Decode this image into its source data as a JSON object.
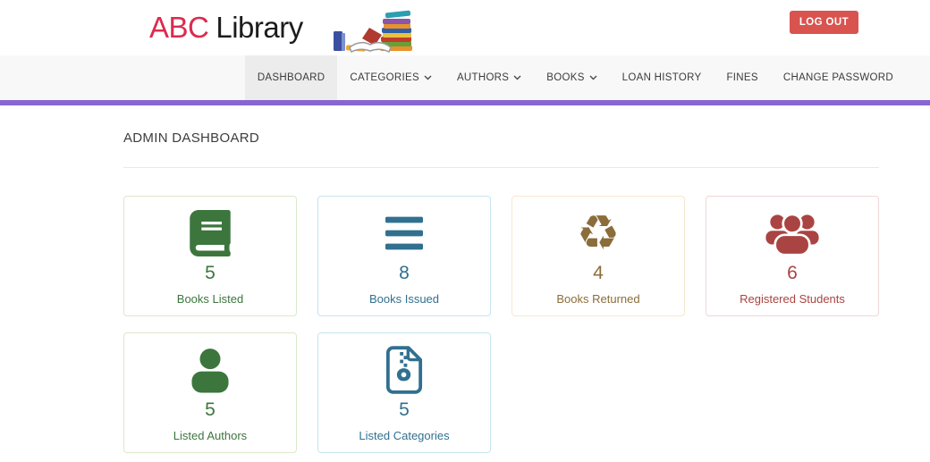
{
  "header": {
    "brand_primary": "ABC",
    "brand_secondary": "Library",
    "logout_button": "LOG OUT"
  },
  "nav": {
    "items": [
      {
        "label": "DASHBOARD",
        "active": true,
        "dropdown": false
      },
      {
        "label": "CATEGORIES",
        "active": false,
        "dropdown": true
      },
      {
        "label": "AUTHORS",
        "active": false,
        "dropdown": true
      },
      {
        "label": "BOOKS",
        "active": false,
        "dropdown": true
      },
      {
        "label": "LOAN HISTORY",
        "active": false,
        "dropdown": false
      },
      {
        "label": "FINES",
        "active": false,
        "dropdown": false
      },
      {
        "label": "CHANGE PASSWORD",
        "active": false,
        "dropdown": false
      }
    ]
  },
  "page": {
    "title": "ADMIN DASHBOARD"
  },
  "stats": [
    {
      "count": "5",
      "label": "Books Listed",
      "icon": "book-icon",
      "color": "#3c763d",
      "border_color": "#dbe8ca"
    },
    {
      "count": "8",
      "label": "Books Issued",
      "icon": "bars-icon",
      "color": "#31708f",
      "border_color": "#c6e6f0"
    },
    {
      "count": "4",
      "label": "Books Returned",
      "icon": "recycle-icon",
      "color": "#8a6d3b",
      "border_color": "#f5e9cd"
    },
    {
      "count": "6",
      "label": "Registered Students",
      "icon": "users-icon",
      "color": "#a94442",
      "border_color": "#efd6d8"
    },
    {
      "count": "5",
      "label": "Listed Authors",
      "icon": "user-icon",
      "color": "#3c763d",
      "border_color": "#dbe8ca"
    },
    {
      "count": "5",
      "label": "Listed Categories",
      "icon": "file-archive-icon",
      "color": "#31708f",
      "border_color": "#c6e6f0"
    }
  ],
  "icons": {
    "book-icon": "solid-book-svg",
    "bars-icon": "three-horizontal-bars-svg",
    "recycle-icon": "♻",
    "users-icon": "group-of-people-svg",
    "user-icon": "single-person-svg",
    "file-archive-icon": "zip-document-svg",
    "chevron-down-icon": "⌄",
    "books-clipart-image": "pile-of-colorful-books"
  },
  "theme": {
    "brand_red": "#dc2a4e",
    "logout_red": "#d9534f",
    "accent_purple": "#8765d3",
    "nav_bg": "#f8f8f8",
    "nav_active_bg": "#ececec",
    "success_green": "#3c763d",
    "info_blue": "#31708f",
    "warning_brown": "#8a6d3b",
    "danger_red": "#a94442"
  }
}
